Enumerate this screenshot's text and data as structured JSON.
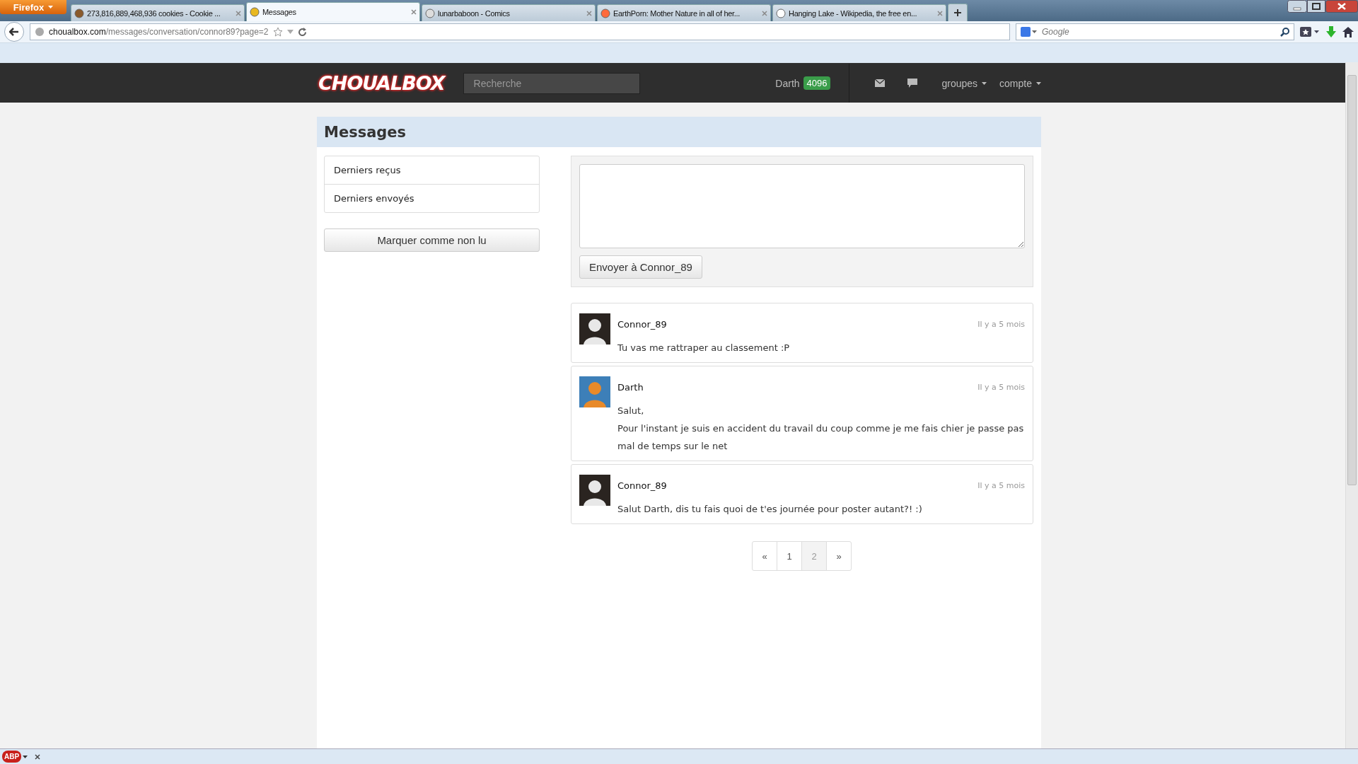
{
  "browser": {
    "menu_button": "Firefox",
    "tabs": [
      {
        "title": "273,816,889,468,936 cookies - Cookie ...",
        "selected": false
      },
      {
        "title": "Messages",
        "selected": true
      },
      {
        "title": "lunarbaboon - Comics",
        "selected": false
      },
      {
        "title": "EarthPorn: Mother Nature in all of her...",
        "selected": false
      },
      {
        "title": "Hanging Lake - Wikipedia, the free en...",
        "selected": false
      }
    ],
    "url": {
      "domain": "choualbox.com",
      "path": "/messages/conversation/connor89?page=2"
    },
    "search_placeholder": "Google"
  },
  "site": {
    "logo": "CHOUALBOX",
    "search_placeholder": "Recherche",
    "user": "Darth",
    "score": "4096",
    "nav": [
      "groupes",
      "compte"
    ]
  },
  "page": {
    "title": "Messages",
    "folders": [
      {
        "label": "Derniers reçus"
      },
      {
        "label": "Derniers envoyés"
      }
    ],
    "mark_unread_button": "Marquer comme non lu",
    "send_button": "Envoyer à Connor_89",
    "messages": [
      {
        "author": "Connor_89",
        "time": "Il y a 5 mois",
        "lines": [
          "Tu vas me rattraper au classement :P"
        ]
      },
      {
        "author": "Darth",
        "time": "Il y a 5 mois",
        "lines": [
          "Salut,",
          "Pour l'instant je suis en accident du travail du coup comme je me fais chier je passe pas mal de temps sur le net"
        ]
      },
      {
        "author": "Connor_89",
        "time": "Il y a 5 mois",
        "lines": [
          "Salut Darth, dis tu fais quoi de t'es journée pour poster autant?! :)"
        ]
      }
    ],
    "pagination": [
      {
        "label": "«",
        "selected": false
      },
      {
        "label": "1",
        "selected": false
      },
      {
        "label": "2",
        "selected": true
      },
      {
        "label": "»",
        "selected": false
      }
    ]
  },
  "status_bar": {
    "addon": "ABP"
  }
}
